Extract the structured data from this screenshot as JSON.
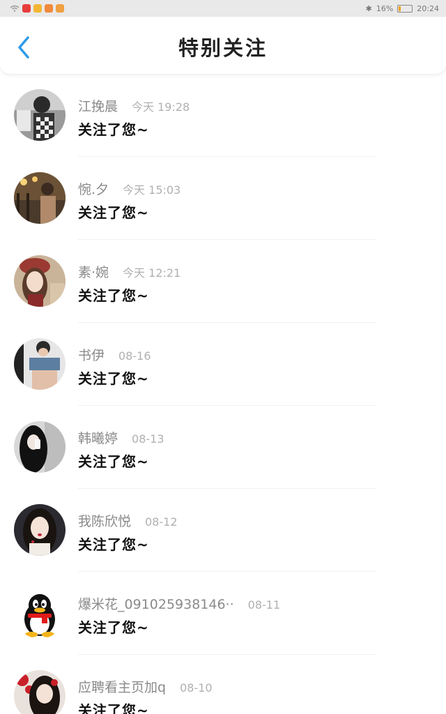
{
  "status_bar": {
    "battery": "16%",
    "battery_level": 0.16,
    "time": "20:24"
  },
  "header": {
    "title": "特别关注",
    "back_icon": "chevron-left-icon"
  },
  "items": [
    {
      "name": "江挽晨",
      "time": "今天 19:28",
      "message": "关注了您~"
    },
    {
      "name": "惋.夕",
      "time": "今天 15:03",
      "message": "关注了您~"
    },
    {
      "name": "素·婉",
      "time": "今天 12:21",
      "message": "关注了您~"
    },
    {
      "name": "书伊",
      "time": "08-16",
      "message": "关注了您~"
    },
    {
      "name": "韩曦婷",
      "time": "08-13",
      "message": "关注了您~"
    },
    {
      "name": "我陈欣悦",
      "time": "08-12",
      "message": "关注了您~"
    },
    {
      "name": "爆米花_091025938146··",
      "time": "08-11",
      "message": "关注了您~"
    },
    {
      "name": "应聘看主页加q",
      "time": "08-10",
      "message": "关注了您~"
    }
  ],
  "colors": {
    "accent": "#2f9be8",
    "status_bar_bg": "#e9e9e9"
  }
}
